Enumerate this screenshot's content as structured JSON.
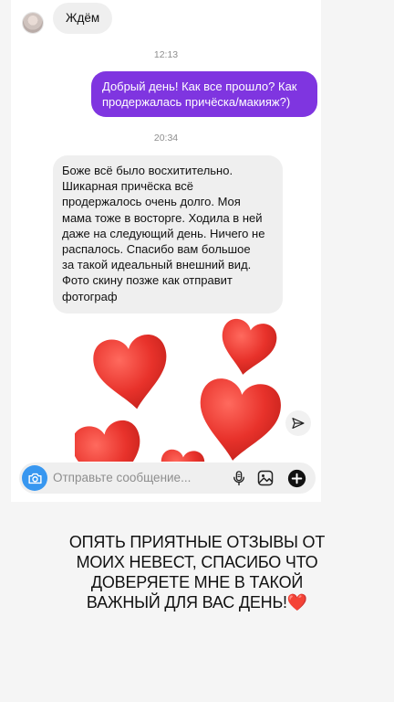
{
  "messages": {
    "first_incoming": "Ждём",
    "time_1": "12:13",
    "outgoing": "Добрый день! Как все прошло? Как продержалась причёска/макияж?)",
    "time_2": "20:34",
    "incoming": "Боже всё было восхитительно.\nШикарная причёска всё\nпродержалось очень долго. Моя\nмама тоже в восторге. Ходила в ней\nдаже на следующий день. Ничего не\nраспалось. Спасибо вам большое\nза такой идеальный внешний вид.\nФото скину позже как отправит\nфотограф"
  },
  "sticker": {
    "name": "hearts-sticker",
    "color": "#e8322b"
  },
  "composer": {
    "placeholder": "Отправьте сообщение..."
  },
  "colors": {
    "outgoing_bubble": "#7f35e0",
    "incoming_bubble": "#efefef",
    "camera_button": "#3897f0"
  },
  "caption": {
    "text": "ОПЯТЬ ПРИЯТНЫЕ ОТЗЫВЫ ОТ МОИХ НЕВЕСТ, СПАСИБО ЧТО ДОВЕРЯЕТЕ МНЕ В ТАКОЙ ВАЖНЫЙ ДЛЯ ВАС ДЕНЬ!",
    "emoji": "❤️"
  }
}
